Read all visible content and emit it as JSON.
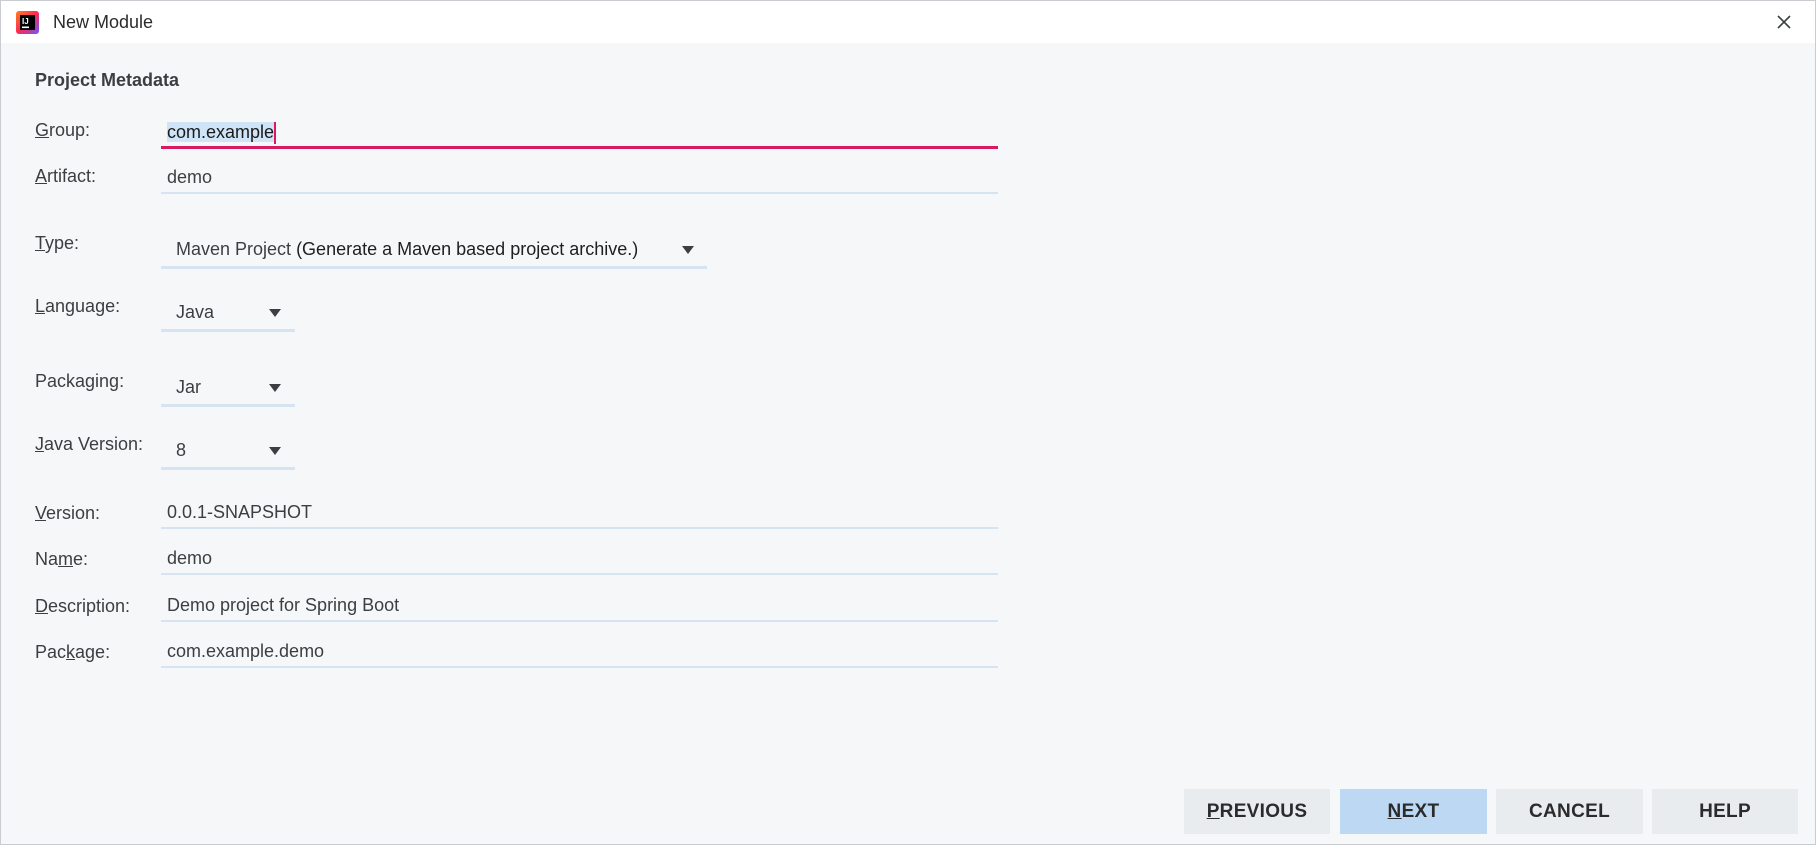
{
  "window": {
    "title": "New Module",
    "app_icon": "intellij-idea-icon",
    "close_icon": "close-icon"
  },
  "section_title": "Project Metadata",
  "fields": {
    "group": {
      "label_mn": "G",
      "label_rest": "roup:",
      "value": "com.example"
    },
    "artifact": {
      "label_mn": "A",
      "label_rest": "rtifact:",
      "value": "demo"
    },
    "version": {
      "label_pre": "",
      "label_mn": "V",
      "label_rest": "ersion:",
      "value": "0.0.1-SNAPSHOT"
    },
    "name": {
      "label_pre": "Na",
      "label_mn": "m",
      "label_rest": "e:",
      "value": "demo"
    },
    "description": {
      "label_pre": "",
      "label_mn": "D",
      "label_rest": "escription:",
      "value": "Demo project for Spring Boot"
    },
    "package": {
      "label_pre": "Pac",
      "label_mn": "k",
      "label_rest": "age:",
      "value": "com.example.demo"
    }
  },
  "combos": {
    "type": {
      "label_mn": "T",
      "label_rest": "ype:",
      "value_main": "Maven Project",
      "value_desc": " (Generate a Maven based project archive.)"
    },
    "language": {
      "label_mn": "L",
      "label_rest": "anguage:",
      "value": "Java"
    },
    "packaging": {
      "label_pre": "Packa",
      "label_mn": "g",
      "label_rest": "ing:",
      "value": "Jar"
    },
    "java_version": {
      "label_mn": "J",
      "label_rest": "ava Version:",
      "value": "8"
    }
  },
  "buttons": {
    "previous": {
      "mn": "P",
      "rest": "REVIOUS"
    },
    "next": {
      "mn": "N",
      "rest": "EXT"
    },
    "cancel": {
      "label": "CANCEL"
    },
    "help": {
      "label": "HELP"
    }
  },
  "colors": {
    "focus_underline": "#d81b60",
    "field_underline": "#d6e4f2",
    "primary_button": "#bcd8f3",
    "background": "#f5f7f9"
  }
}
